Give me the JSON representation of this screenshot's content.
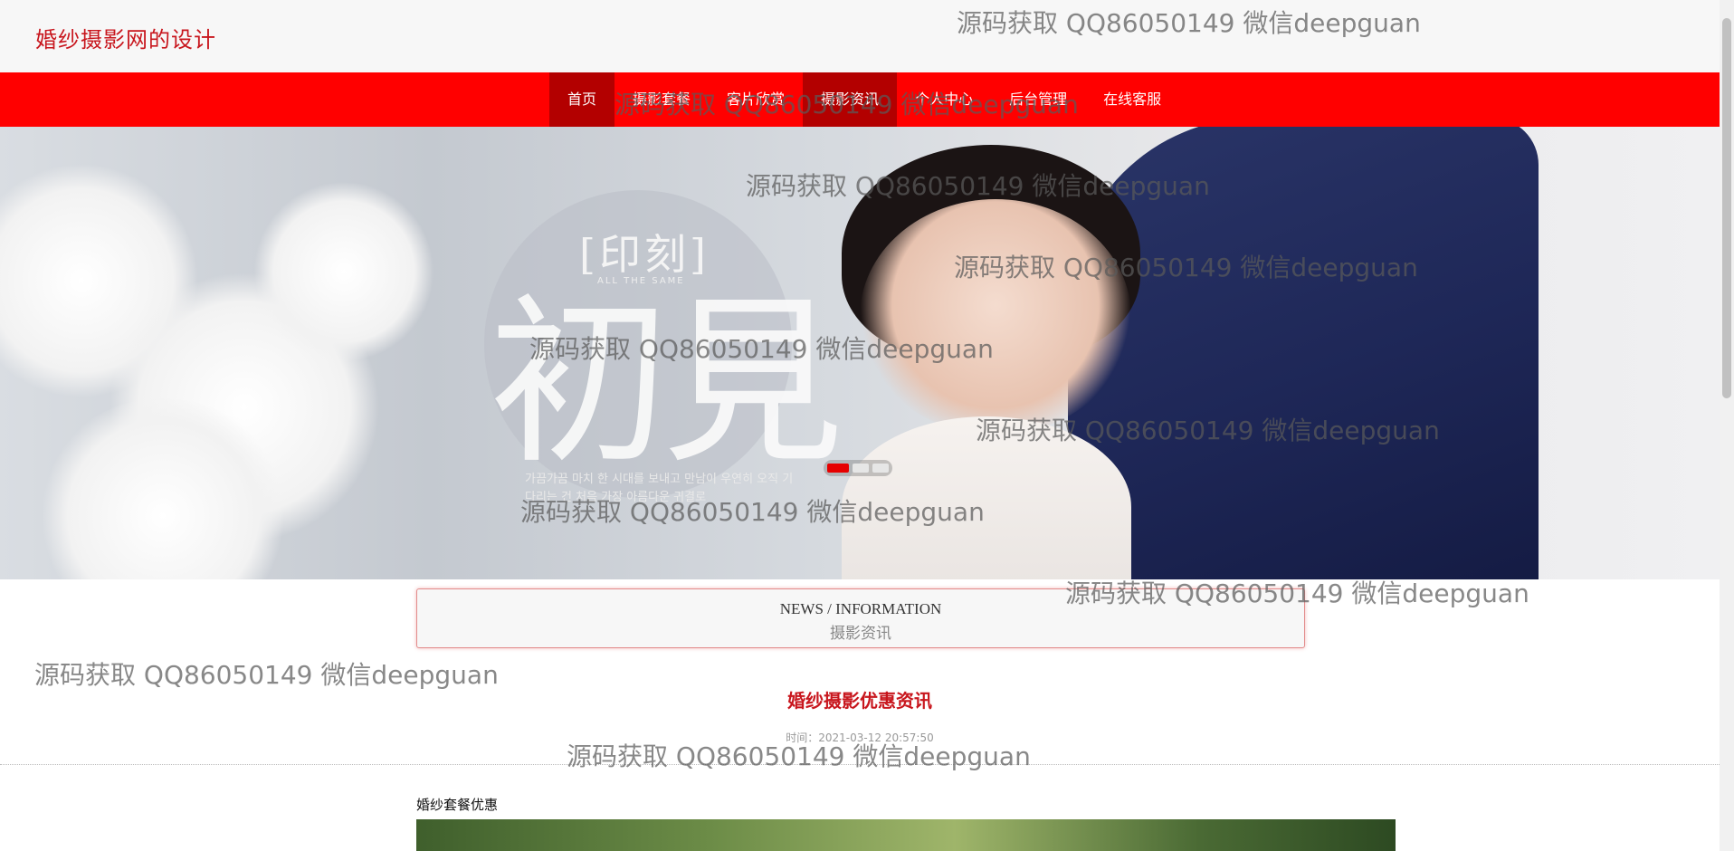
{
  "site": {
    "title": "婚纱摄影网的设计"
  },
  "nav": {
    "items": [
      "首页",
      "摄影套餐",
      "客片欣赏",
      "摄影资讯",
      "个人中心",
      "后台管理",
      "在线客服"
    ]
  },
  "banner": {
    "stamp_text": "[印刻]",
    "stamp_sub": "ALL THE SAME",
    "big_text": "初見",
    "korean_text": "가끔가끔 마치 한 시대를 보내고 만남이 우연히 오직 기다리는 건 처음 가장 아름다운 귀결로"
  },
  "section": {
    "title_en": "NEWS / INFORMATION",
    "title_cn": "摄影资讯"
  },
  "article": {
    "title": "婚纱摄影优惠资讯",
    "meta": "时间：2021-03-12 20:57:50",
    "subtitle": "婚纱套餐优惠"
  },
  "watermark": {
    "text": "源码获取 QQ86050149 微信deepguan"
  },
  "colors": {
    "nav_bg": "#ff0000",
    "nav_active": "#b30000",
    "brand": "#c8161d"
  }
}
